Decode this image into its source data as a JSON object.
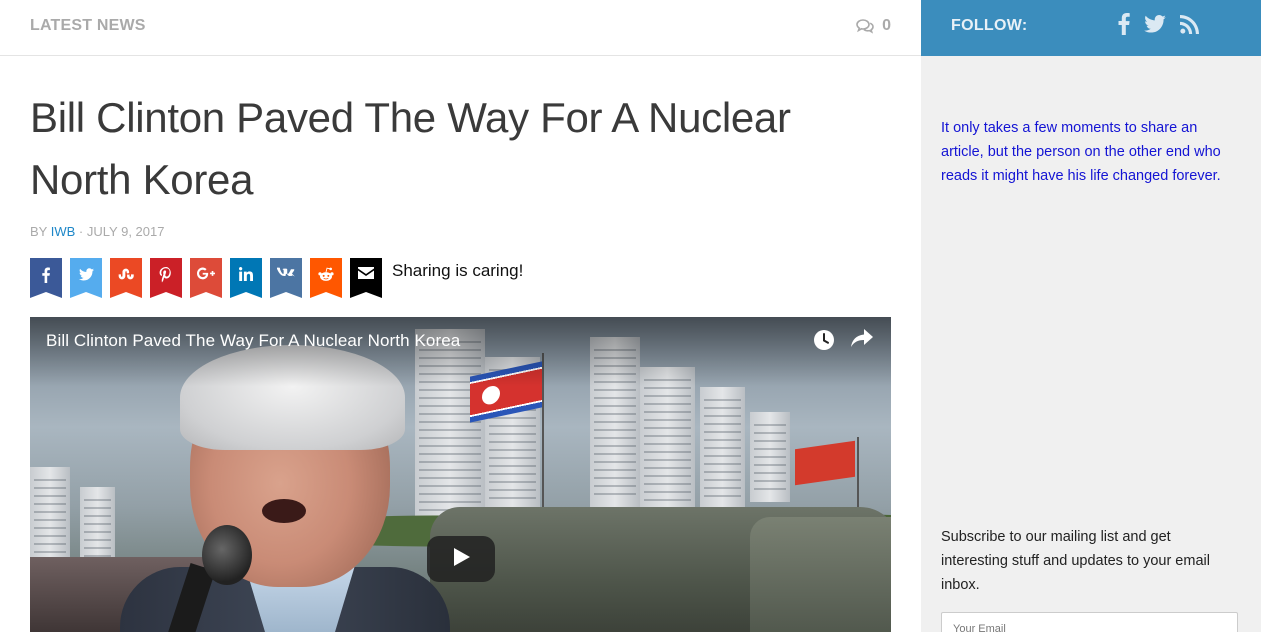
{
  "header": {
    "section_label": "LATEST NEWS",
    "comment_icon": "comments-icon",
    "comment_count": "0"
  },
  "article": {
    "title": "Bill Clinton Paved The Way For A Nuclear North Korea",
    "byline_prefix": "BY",
    "author": "IWB",
    "separator": "·",
    "date": "JULY 9, 2017"
  },
  "share": {
    "buttons": [
      {
        "name": "facebook",
        "icon": "facebook-icon",
        "color": "#3b5998"
      },
      {
        "name": "twitter",
        "icon": "twitter-icon",
        "color": "#55acee"
      },
      {
        "name": "stumbleupon",
        "icon": "stumbleupon-icon",
        "color": "#eb4924"
      },
      {
        "name": "pinterest",
        "icon": "pinterest-icon",
        "color": "#cb2027"
      },
      {
        "name": "google-plus",
        "icon": "google-plus-icon",
        "color": "#dd4b39"
      },
      {
        "name": "linkedin",
        "icon": "linkedin-icon",
        "color": "#0077b5"
      },
      {
        "name": "vk",
        "icon": "vk-icon",
        "color": "#4c75a3"
      },
      {
        "name": "reddit",
        "icon": "reddit-icon",
        "color": "#ff5700"
      },
      {
        "name": "email",
        "icon": "envelope-icon",
        "color": "#000000"
      }
    ],
    "caption": "Sharing is caring!"
  },
  "video": {
    "title": "Bill Clinton Paved The Way For A Nuclear North Korea",
    "watch_later_icon": "clock-icon",
    "share_icon": "share-arrow-icon",
    "play_icon": "play-icon"
  },
  "sidebar": {
    "follow_label": "FOLLOW:",
    "social_icons": [
      "facebook-icon",
      "twitter-icon",
      "rss-icon"
    ],
    "accent_color": "#3b8dbd",
    "promo_text": "It only takes a few moments to share an article, but the person on the other end who reads it might have his life changed forever.",
    "subscribe_text": "Subscribe to our mailing list and get interesting stuff and updates to your email inbox.",
    "email_placeholder": "Your Email"
  }
}
